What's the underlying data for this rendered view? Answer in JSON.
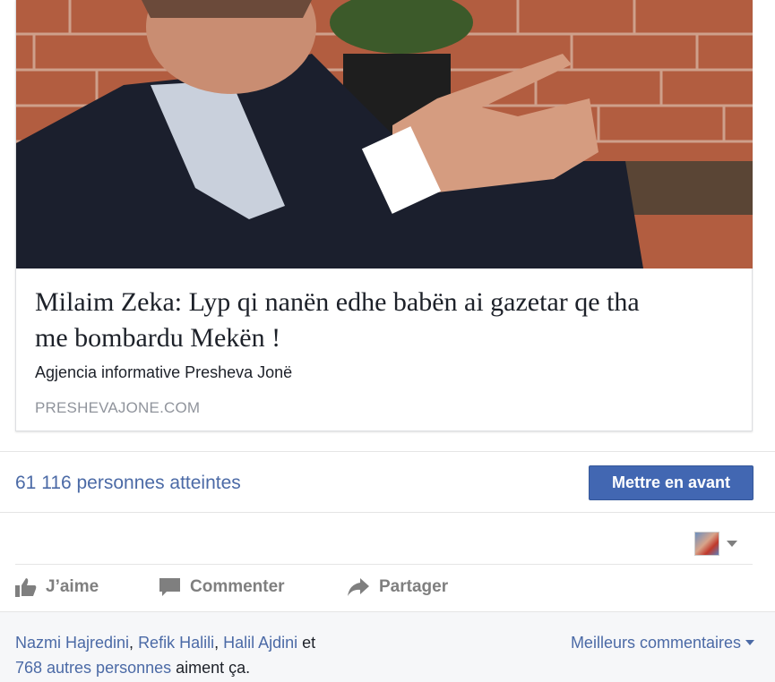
{
  "post": {
    "headline_line1": "Milaim Zeka: Lyp qi nanën edhe babën ai gazetar qe tha",
    "headline_line2": "me bombardu Mekën !",
    "source_name": "Agjencia informative Presheva Jonë",
    "domain": "PRESHEVAJONE.COM"
  },
  "stats": {
    "reach": "61 116 personnes atteintes",
    "boost_button": "Mettre en avant"
  },
  "actions": {
    "like": "J’aime",
    "comment": "Commenter",
    "share": "Partager"
  },
  "likes": {
    "name1": "Nazmi Hajredini",
    "sep1": ", ",
    "name2": "Refik Halili",
    "sep2": ", ",
    "name3": "Halil Ajdini",
    "and": " et ",
    "others": "768 autres personnes",
    "suffix": " aiment ça."
  },
  "comments_filter": "Meilleurs commentaires",
  "colors": {
    "link": "#4b6aa6",
    "button": "#4267b2",
    "action_gray": "#7f7f7f",
    "muted": "#90949c"
  },
  "icons": [
    "thumbs-up-icon",
    "comment-bubble-icon",
    "share-arrow-icon",
    "chevron-down-icon"
  ]
}
